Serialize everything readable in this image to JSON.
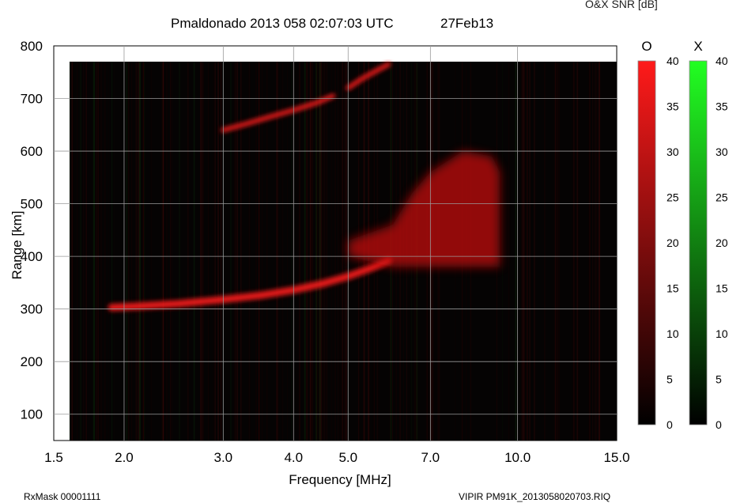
{
  "header": {
    "station_line": "Pmaldonado 2013 058 02:07:03 UTC",
    "date": "27Feb13",
    "snr_label": "O&X SNR [dB]"
  },
  "footer": {
    "rx_mask": "RxMask 00001111",
    "file": "VIPIR  PM91K_2013058020703.RIQ"
  },
  "chart_data": {
    "type": "heatmap",
    "title": "Pmaldonado 2013 058 02:07:03 UTC",
    "xlabel": "Frequency [MHz]",
    "ylabel": "Range [km]",
    "x_scale": "log",
    "xlim": [
      1.5,
      15.0
    ],
    "ylim": [
      50,
      800
    ],
    "x_ticks": [
      1.5,
      2.0,
      3.0,
      4.0,
      5.0,
      7.0,
      10.0,
      15.0
    ],
    "x_tick_labels": [
      "1.5",
      "2.0",
      "3.0",
      "4.0",
      "5.0",
      "7.0",
      "10.0",
      "15.0"
    ],
    "y_ticks": [
      100,
      200,
      300,
      400,
      500,
      600,
      700,
      800
    ],
    "y_tick_labels": [
      "100",
      "200",
      "300",
      "400",
      "500",
      "600",
      "700",
      "800"
    ],
    "data_extent": {
      "x": [
        1.6,
        15.0
      ],
      "y": [
        50,
        770
      ]
    },
    "grid": true,
    "colorbars": [
      {
        "name": "O",
        "color": "#ff1a1a",
        "range": [
          0,
          40
        ],
        "ticks": [
          0,
          5,
          10,
          15,
          20,
          25,
          30,
          35,
          40
        ]
      },
      {
        "name": "X",
        "color": "#22ff22",
        "range": [
          0,
          40
        ],
        "ticks": [
          0,
          5,
          10,
          15,
          20,
          25,
          30,
          35,
          40
        ]
      }
    ],
    "traces": [
      {
        "name": "O",
        "segment": "F-trace lower",
        "x": [
          1.9,
          2.1,
          2.5,
          3.0,
          3.5,
          4.0,
          4.5,
          5.0,
          5.5,
          5.9
        ],
        "y": [
          303,
          305,
          310,
          318,
          326,
          336,
          348,
          362,
          378,
          392
        ]
      },
      {
        "name": "O",
        "segment": "multi-hop trace",
        "x": [
          3.0,
          3.3,
          3.6,
          4.0,
          4.4,
          4.7
        ],
        "y": [
          640,
          652,
          664,
          678,
          692,
          705
        ]
      },
      {
        "name": "O",
        "segment": "upper fragment",
        "x": [
          5.0,
          5.3,
          5.6,
          5.9
        ],
        "y": [
          720,
          738,
          752,
          765
        ]
      },
      {
        "name": "O",
        "segment": "spread echo block",
        "x": [
          5.0,
          6.0,
          6.5,
          7.0,
          8.0,
          9.0,
          9.3
        ],
        "y": [
          430,
          460,
          520,
          560,
          600,
          590,
          560
        ]
      }
    ]
  }
}
